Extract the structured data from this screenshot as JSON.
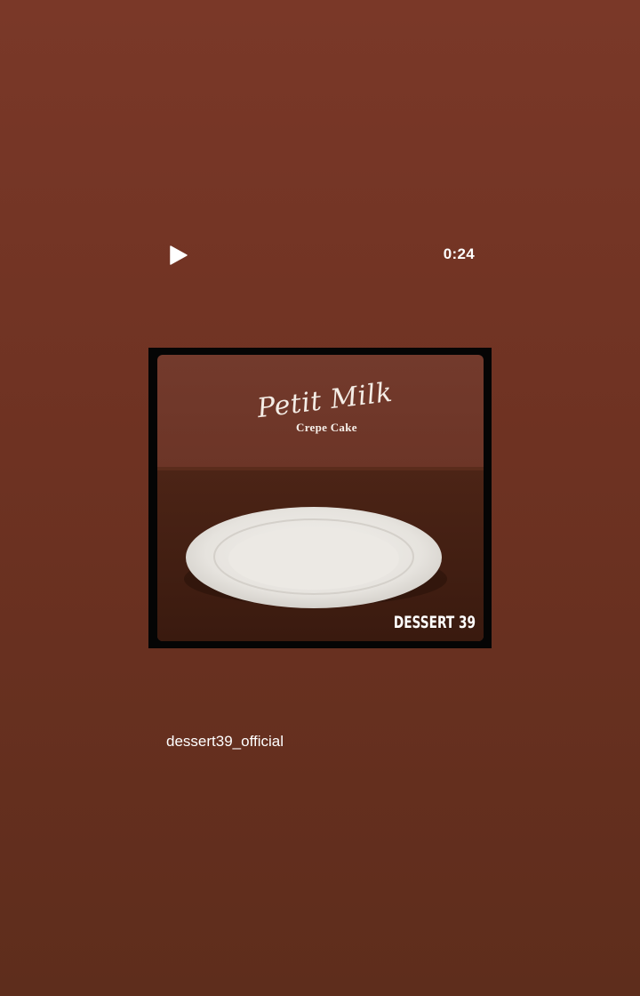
{
  "player": {
    "duration": "0:24",
    "play_icon": "play-icon"
  },
  "cover": {
    "title": "Petit Milk",
    "subtitle": "Crepe Cake",
    "brand": "DESSERT 39"
  },
  "account": {
    "username": "dessert39_official"
  },
  "colors": {
    "background_top": "#7a3828",
    "background_bottom": "#5e2d1c",
    "frame": "#050505",
    "text": "#ffffff"
  }
}
